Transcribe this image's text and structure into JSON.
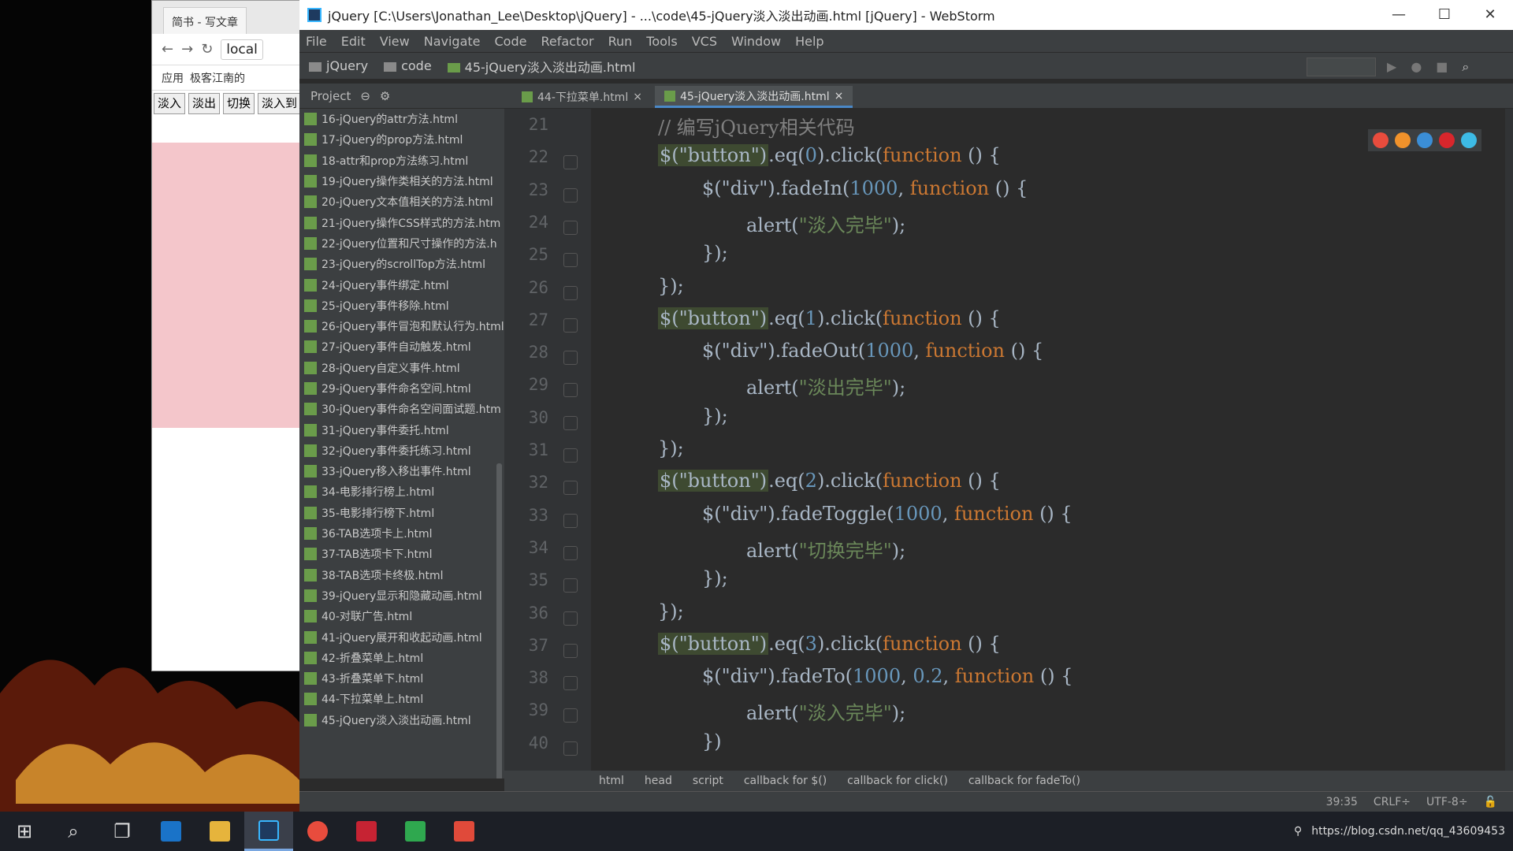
{
  "browser": {
    "tab_title": "简书 - 写文章",
    "address": "local",
    "bookmarks": [
      "应用",
      "极客江南的"
    ],
    "buttons": [
      "淡入",
      "淡出",
      "切换",
      "淡入到"
    ]
  },
  "ide": {
    "window_title": "jQuery [C:\\Users\\Jonathan_Lee\\Desktop\\jQuery] - ...\\code\\45-jQuery淡入淡出动画.html [jQuery] - WebStorm",
    "menu": [
      "File",
      "Edit",
      "View",
      "Navigate",
      "Code",
      "Refactor",
      "Run",
      "Tools",
      "VCS",
      "Window",
      "Help"
    ],
    "nav_path": [
      "jQuery",
      "code",
      "45-jQuery淡入淡出动画.html"
    ],
    "project_label": "Project",
    "tree": [
      "16-jQuery的attr方法.html",
      "17-jQuery的prop方法.html",
      "18-attr和prop方法练习.html",
      "19-jQuery操作类相关的方法.html",
      "20-jQuery文本值相关的方法.html",
      "21-jQuery操作CSS样式的方法.htm",
      "22-jQuery位置和尺寸操作的方法.h",
      "23-jQuery的scrollTop方法.html",
      "24-jQuery事件绑定.html",
      "25-jQuery事件移除.html",
      "26-jQuery事件冒泡和默认行为.html",
      "27-jQuery事件自动触发.html",
      "28-jQuery自定义事件.html",
      "29-jQuery事件命名空间.html",
      "30-jQuery事件命名空间面试题.htm",
      "31-jQuery事件委托.html",
      "32-jQuery事件委托练习.html",
      "33-jQuery移入移出事件.html",
      "34-电影排行榜上.html",
      "35-电影排行榜下.html",
      "36-TAB选项卡上.html",
      "37-TAB选项卡下.html",
      "38-TAB选项卡终极.html",
      "39-jQuery显示和隐藏动画.html",
      "40-对联广告.html",
      "41-jQuery展开和收起动画.html",
      "42-折叠菜单上.html",
      "43-折叠菜单下.html",
      "44-下拉菜单上.html",
      "45-jQuery淡入淡出动画.html"
    ],
    "tabs": [
      "44-下拉菜单.html",
      "45-jQuery淡入淡出动画.html"
    ],
    "line_numbers": [
      "21",
      "22",
      "23",
      "24",
      "25",
      "26",
      "27",
      "28",
      "29",
      "30",
      "31",
      "32",
      "33",
      "34",
      "35",
      "36",
      "37",
      "38",
      "39",
      "40"
    ],
    "code": {
      "comment": "// 编写jQuery相关代码",
      "sel_button": "$(\"button\")",
      "sel_div": "$(\"div\")",
      "eq0": ".eq(",
      "click": ").click(",
      "function_kw": "function",
      "fn_tail": " () {",
      "close_cb": "});",
      "close_last": "})",
      "fadeIn": ".fadeIn(",
      "fadeOut": ".fadeOut(",
      "fadeToggle": ".fadeToggle(",
      "fadeTo": ".fadeTo(",
      "alert": "alert(",
      "alert_end": ");",
      "msg_in": "\"淡入完毕\"",
      "msg_out": "\"淡出完毕\"",
      "msg_toggle": "\"切换完毕\"",
      "n0": "0",
      "n1": "1",
      "n2": "2",
      "n3": "3",
      "n1000": "1000",
      "n02": "0.2",
      "comma": ", "
    },
    "breadcrumb": [
      "html",
      "head",
      "script",
      "callback for $()",
      "callback for click()",
      "callback for fadeTo()"
    ],
    "status": {
      "position": "39:35",
      "line_sep": "CRLF÷",
      "encoding": "UTF-8÷"
    }
  },
  "taskbar": {
    "watermark": "https://blog.csdn.net/qq_43609453"
  },
  "colors": {
    "keyword": "#cc7832",
    "string": "#6a8759",
    "number": "#6897bb",
    "editor_bg": "#2b2b2b",
    "selection_hl": "#3e4a31"
  }
}
